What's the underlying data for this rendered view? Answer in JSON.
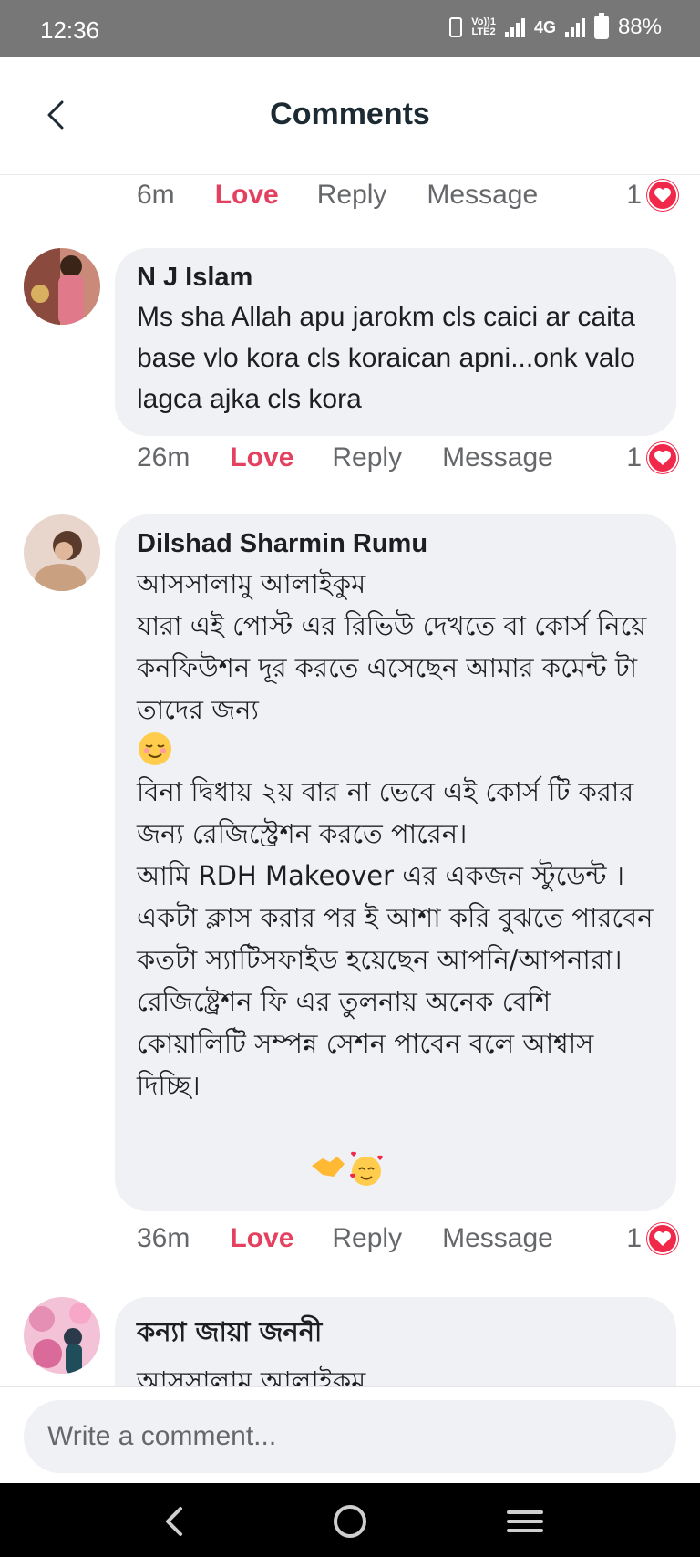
{
  "status_bar": {
    "time": "12:36",
    "volte_top": "Vo))1",
    "volte_bottom": "LTE2",
    "network": "4G",
    "battery": "88%"
  },
  "header": {
    "title": "Comments"
  },
  "comments": [
    {
      "time": "6m",
      "love_label": "Love",
      "reply_label": "Reply",
      "message_label": "Message",
      "reaction_count": "1"
    },
    {
      "author": "N J Islam",
      "text": "Ms sha Allah apu jarokm cls caici ar caita base vlo kora cls koraican apni...onk valo lagca ajka  cls kora",
      "time": "26m",
      "love_label": "Love",
      "reply_label": "Reply",
      "message_label": "Message",
      "reaction_count": "1"
    },
    {
      "author": "Dilshad Sharmin Rumu",
      "text_1": "আসসালামু আলাইকুম\nযারা এই পোস্ট এর রিভিউ দেখতে বা কোর্স নিয়ে কনফিউশন দূর করতে এসেছেন আমার কমেন্ট টা তাদের জন্য",
      "text_2": "বিনা দ্বিধায় ২য় বার না ভেবে এই কোর্স টি করার জন্য রেজিস্ট্রেশন করতে পারেন।\nআমি RDH Makeover এর একজন স্টুডেন্ট । একটা ক্লাস করার পর ই আশা করি বুঝতে পারবেন কতটা স্যাটিসফাইড হয়েছেন আপনি/আপনারা।\nরেজিষ্ট্রেশন ফি এর তুলনায় অনেক বেশি কোয়ালিটি সম্পন্ন সেশন পাবেন বলে আশ্বাস দিচ্ছি।",
      "time": "36m",
      "love_label": "Love",
      "reply_label": "Reply",
      "message_label": "Message",
      "reaction_count": "1"
    },
    {
      "author": "কন্যা জায়া জননী",
      "text": "আসসালামু আলাইকুম"
    }
  ],
  "input": {
    "placeholder": "Write a comment..."
  },
  "colors": {
    "love": "#e4405f",
    "bubble": "#f0f1f4",
    "status_bar": "#777777"
  }
}
